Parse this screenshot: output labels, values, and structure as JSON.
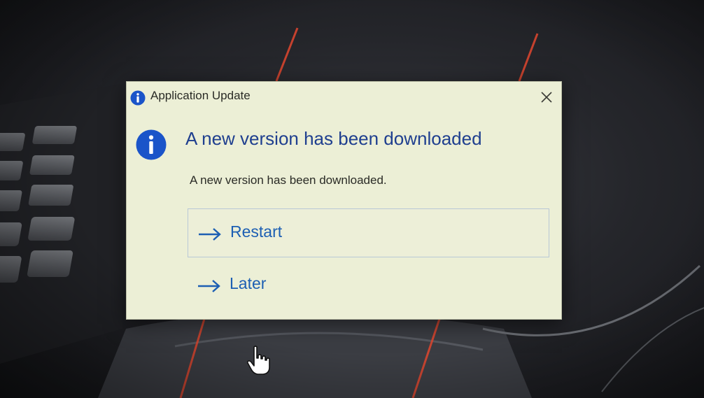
{
  "dialog": {
    "title": "Application Update",
    "heading": "A new version has been downloaded",
    "content": "A new version has been downloaded.",
    "close_icon": "close-icon",
    "info_icon": "info-icon"
  },
  "actions": [
    {
      "label": "Restart",
      "icon": "arrow-right-icon",
      "highlighted": true
    },
    {
      "label": "Later",
      "icon": "arrow-right-icon",
      "highlighted": false
    }
  ],
  "colors": {
    "dialog_background": "#ecefd6",
    "heading": "#1f3f8f",
    "link": "#1d5fb3",
    "info_icon": "#1a54c9"
  }
}
